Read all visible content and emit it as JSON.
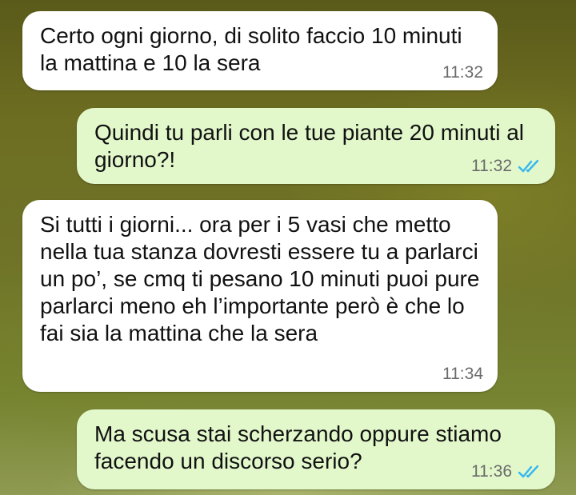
{
  "messages": [
    {
      "direction": "incoming",
      "text": "Certo ogni giorno, di solito faccio 10 minuti la mattina e 10 la sera",
      "time": "11:32"
    },
    {
      "direction": "outgoing",
      "text": "Quindi tu parli con le tue piante 20 minuti al giorno?!",
      "time": "11:32",
      "status_icon": "double-check-read-icon"
    },
    {
      "direction": "incoming",
      "text": "Si tutti i giorni... ora per i 5 vasi che metto nella tua stanza dovresti essere tu a parlarci un po’, se cmq ti pesano 10 minuti puoi pure parlarci meno eh l’importante però è che lo fai sia la mattina che la sera",
      "time": "11:34"
    },
    {
      "direction": "outgoing",
      "text": "Ma scusa stai scherzando oppure stiamo facendo un discorso serio?",
      "time": "11:36",
      "status_icon": "double-check-read-icon"
    }
  ],
  "colors": {
    "incoming_bubble": "#ffffff",
    "outgoing_bubble": "#e2f8cb",
    "read_ticks": "#34b7f1",
    "timestamp": "#6a6a6a"
  }
}
